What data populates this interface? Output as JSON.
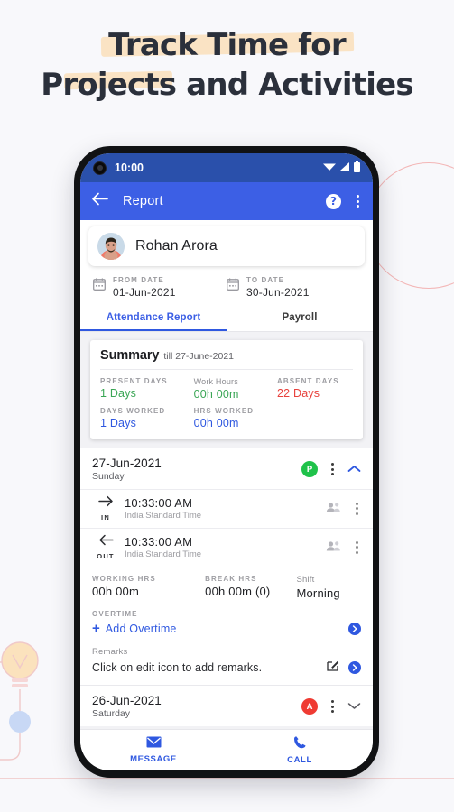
{
  "headline": {
    "line1": "Track Time for",
    "line2": "Projects and Activities"
  },
  "colors": {
    "accent_blue": "#3c5fe5",
    "statusbar_blue": "#2a50ab",
    "present_green": "#3aa655",
    "absent_red": "#e8413c",
    "link_blue": "#2f58e0",
    "page_bg": "#f8f8fb",
    "highlight_peach": "#fadfba"
  },
  "phone": {
    "statusbar": {
      "time": "10:00",
      "icons": [
        "wifi-icon",
        "signal-icon",
        "battery-icon"
      ]
    },
    "appbar": {
      "back_icon": "back-arrow-icon",
      "title": "Report",
      "help_label": "?",
      "overflow_icon": "kebab-menu-icon"
    },
    "profile": {
      "name": "Rohan Arora",
      "avatar": "user-avatar"
    },
    "date_range": {
      "from": {
        "label": "FROM DATE",
        "value": "01-Jun-2021",
        "icon": "calendar-icon"
      },
      "to": {
        "label": "TO DATE",
        "value": "30-Jun-2021",
        "icon": "calendar-icon"
      }
    },
    "tabs": [
      {
        "label": "Attendance Report",
        "active": true
      },
      {
        "label": "Payroll",
        "active": false
      }
    ],
    "summary": {
      "title": "Summary",
      "subtitle": "till 27-June-2021",
      "row1": [
        {
          "label": "PRESENT DAYS",
          "value": "1 Days",
          "color": "green"
        },
        {
          "label": "Work Hours",
          "value": "00h 00m",
          "color": "green"
        },
        {
          "label": "ABSENT DAYS",
          "value": "22 Days",
          "color": "red"
        }
      ],
      "row2": [
        {
          "label": "DAYS WORKED",
          "value": "1 Days",
          "color": "blue"
        },
        {
          "label": "HRS WORKED",
          "value": "00h 00m",
          "color": "blue"
        }
      ]
    },
    "records": [
      {
        "date": "27-Jun-2021",
        "day": "Sunday",
        "badge": "P",
        "badge_type": "p",
        "expanded": true,
        "chevron": "chevron-up-icon",
        "punches": [
          {
            "direction": "IN",
            "icon": "arrow-right-icon",
            "time": "10:33:00 AM",
            "timezone": "India Standard Time"
          },
          {
            "direction": "OUT",
            "icon": "arrow-left-icon",
            "time": "10:33:00 AM",
            "timezone": "India Standard Time"
          }
        ],
        "hours": [
          {
            "label": "WORKING HRS",
            "value": "00h 00m"
          },
          {
            "label": "BREAK HRS",
            "value": "00h 00m (0)"
          },
          {
            "label": "Shift",
            "value": "Morning"
          }
        ],
        "overtime": {
          "label": "OVERTIME",
          "action_label": "Add Overtime"
        },
        "remarks": {
          "label": "Remarks",
          "text": "Click on edit icon to add remarks."
        }
      },
      {
        "date": "26-Jun-2021",
        "day": "Saturday",
        "badge": "A",
        "badge_type": "a",
        "expanded": false,
        "chevron": "chevron-down-icon"
      }
    ],
    "bottom_nav": [
      {
        "label": "MESSAGE",
        "icon": "mail-icon"
      },
      {
        "label": "CALL",
        "icon": "phone-icon"
      }
    ]
  }
}
